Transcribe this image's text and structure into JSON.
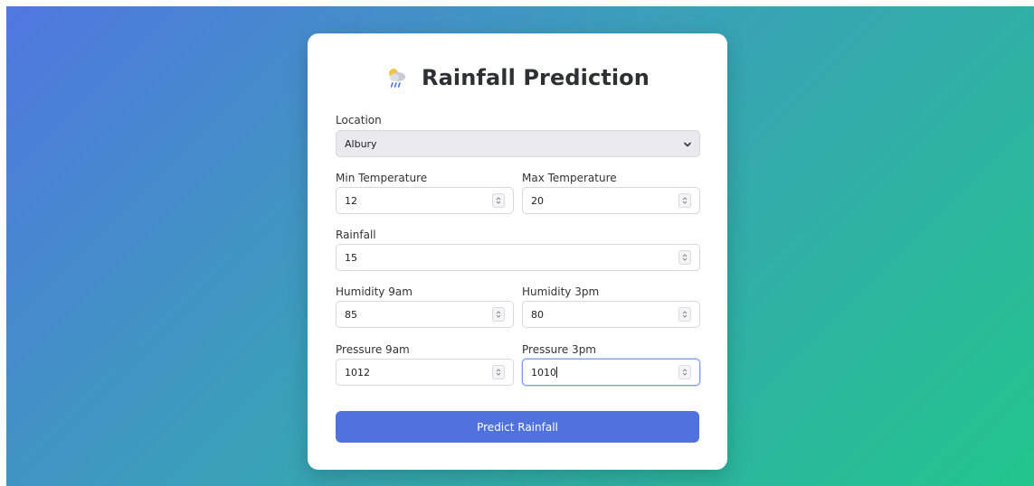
{
  "header": {
    "title": "Rainfall Prediction",
    "icon": "rain-cloud-icon"
  },
  "form": {
    "location": {
      "label": "Location",
      "selected": "Albury"
    },
    "min_temperature": {
      "label": "Min Temperature",
      "value": "12"
    },
    "max_temperature": {
      "label": "Max Temperature",
      "value": "20"
    },
    "rainfall": {
      "label": "Rainfall",
      "value": "15"
    },
    "humidity_9am": {
      "label": "Humidity 9am",
      "value": "85"
    },
    "humidity_3pm": {
      "label": "Humidity 3pm",
      "value": "80"
    },
    "pressure_9am": {
      "label": "Pressure 9am",
      "value": "1012"
    },
    "pressure_3pm": {
      "label": "Pressure 3pm",
      "value": "1010",
      "focused": true
    },
    "submit_label": "Predict Rainfall"
  },
  "colors": {
    "background_gradient_start": "#5077e0",
    "background_gradient_end": "#22c58c",
    "button": "#4f72de",
    "card": "#ffffff",
    "select_background": "#e9e9ee"
  }
}
